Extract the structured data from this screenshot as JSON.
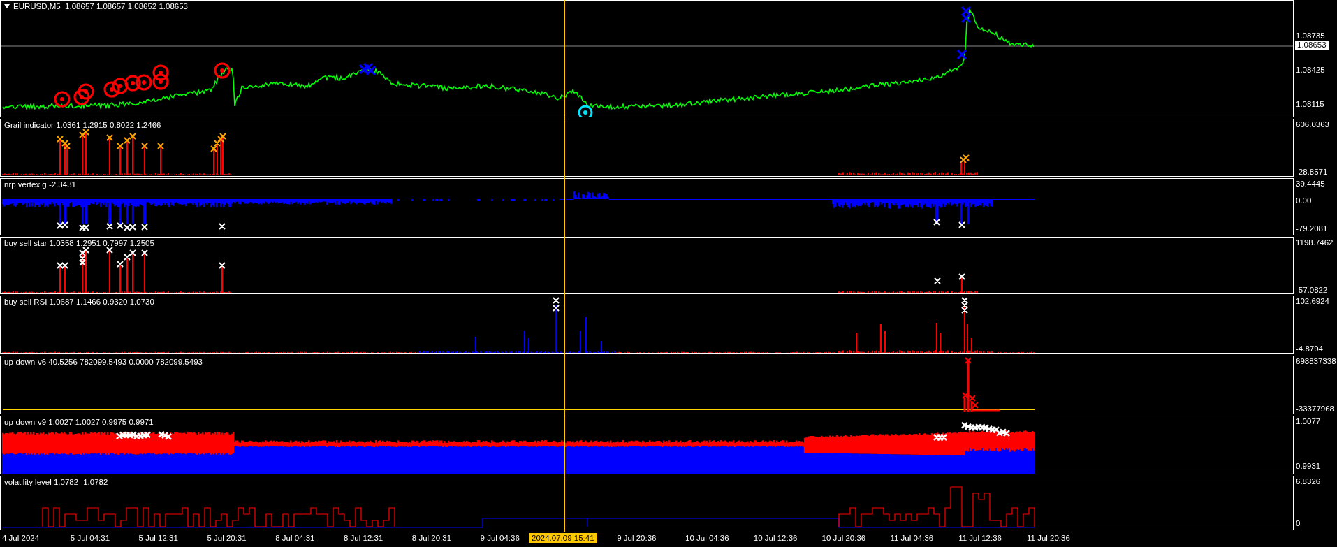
{
  "main": {
    "title": "EURUSD,M5  1.08657 1.08657 1.08652 1.08653",
    "scale": [
      {
        "text": "1.08735",
        "kind": "tick"
      },
      {
        "text": "1.08653",
        "kind": "current"
      },
      {
        "text": "1.08425",
        "kind": "tick"
      },
      {
        "text": "1.08115",
        "kind": "tick"
      }
    ]
  },
  "panels": [
    {
      "kind": "grail",
      "title": "Grail indicator 1.0361 1.2915 0.8022 1.2466",
      "scale": [
        "606.0363",
        "-28.8571"
      ]
    },
    {
      "kind": "nrp",
      "title": "nrp vertex g -2.3431",
      "scale": [
        "39.4445",
        "0.00",
        "-79.2081"
      ]
    },
    {
      "kind": "star",
      "title": "buy sell star 1.0358 1.2951 0.7997 1.2505",
      "scale": [
        "1198.7462",
        "-57.0822"
      ]
    },
    {
      "kind": "rsi",
      "title": "buy sell RSI 1.0687 1.1466 0.9320 1.0730",
      "scale": [
        "102.6924",
        "-4.8794"
      ]
    },
    {
      "kind": "v6",
      "title": "up-down-v6 40.5256 782099.5493 0.0000 782099.5493",
      "scale": [
        "698837338",
        "-33377968"
      ]
    },
    {
      "kind": "v9",
      "title": "up-down-v9 1.0027 1.0027 0.9975 0.9971",
      "scale": [
        "1.0077",
        "0.9931"
      ]
    },
    {
      "kind": "volatility",
      "title": "volatility level 1.0782 -1.0782",
      "scale": [
        "6.8326",
        "0"
      ]
    }
  ],
  "time_axis": {
    "labels": [
      "4 Jul 2024",
      "5 Jul 04:31",
      "5 Jul 12:31",
      "5 Jul 20:31",
      "8 Jul 04:31",
      "8 Jul 12:31",
      "8 Jul 20:31",
      "9 Jul 04:36",
      "9 Jul 20:36",
      "10 Jul 04:36",
      "10 Jul 12:36",
      "10 Jul 20:36",
      "11 Jul 04:36",
      "11 Jul 12:36",
      "11 Jul 20:36"
    ],
    "cursor_time": "2024.07.09 15:41"
  }
}
